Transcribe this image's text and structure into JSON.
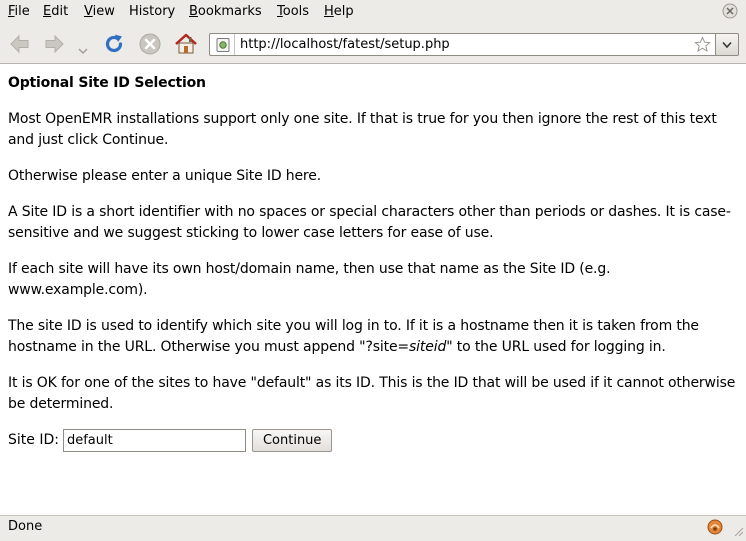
{
  "menubar": {
    "items": [
      {
        "mnemonic": "F",
        "rest": "ile"
      },
      {
        "mnemonic": "E",
        "rest": "dit"
      },
      {
        "mnemonic": "V",
        "rest": "iew"
      },
      {
        "mnemonic": "",
        "rest": "History"
      },
      {
        "mnemonic": "B",
        "rest": "ookmarks"
      },
      {
        "mnemonic": "T",
        "rest": "ools"
      },
      {
        "mnemonic": "H",
        "rest": "elp"
      }
    ]
  },
  "toolbar": {
    "url": "http://localhost/fatest/setup.php",
    "icons": [
      "back-arrow-icon",
      "forward-arrow-icon",
      "chevron-down-icon",
      "reload-icon",
      "stop-icon",
      "home-icon",
      "site-identity-icon",
      "bookmark-star-icon"
    ]
  },
  "page": {
    "heading": "Optional Site ID Selection",
    "para1": "Most OpenEMR installations support only one site. If that is true for you then ignore the rest of this text and just click Continue.",
    "para2": "Otherwise please enter a unique Site ID here.",
    "para3": "A Site ID is a short identifier with no spaces or special characters other than periods or dashes. It is case-sensitive and we suggest sticking to lower case letters for ease of use.",
    "para4": "If each site will have its own host/domain name, then use that name as the Site ID (e.g. www.example.com).",
    "para5_before": "The site ID is used to identify which site you will log in to. If it is a hostname then it is taken from the hostname in the URL. Otherwise you must append \"?site=",
    "para5_em": "siteid",
    "para5_after": "\" to the URL used for logging in.",
    "para6": "It is OK for one of the sites to have \"default\" as its ID. This is the ID that will be used if it cannot otherwise be determined.",
    "form": {
      "site_label": "Site ID:",
      "site_value": "default",
      "continue_label": "Continue"
    }
  },
  "statusbar": {
    "text": "Done"
  }
}
